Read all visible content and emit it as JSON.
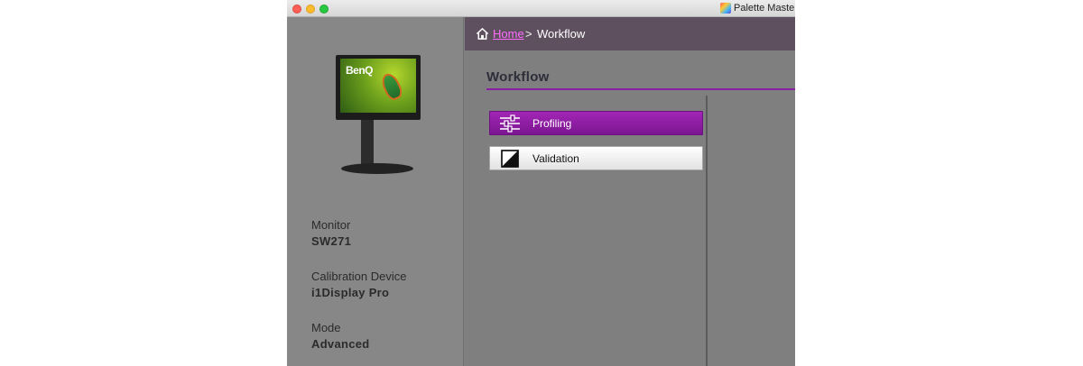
{
  "window": {
    "app_title": "Palette Master"
  },
  "sidebar": {
    "monitor_brand": "BenQ",
    "info": [
      {
        "label": "Monitor",
        "value": "SW271"
      },
      {
        "label": "Calibration Device",
        "value": "i1Display Pro"
      },
      {
        "label": "Mode",
        "value": "Advanced"
      }
    ]
  },
  "breadcrumb": {
    "home": "Home",
    "separator": ">",
    "current": "Workflow"
  },
  "main": {
    "title": "Workflow",
    "buttons": [
      {
        "label": "Profiling",
        "icon": "sliders-icon",
        "state": "selected"
      },
      {
        "label": "Validation",
        "icon": "contrast-square-icon",
        "state": "normal"
      }
    ]
  },
  "colors": {
    "accent": "#8a1da5",
    "breadcrumb_bg": "#5f5060",
    "home_link": "#ff6bff",
    "panel_bg": "#808080"
  }
}
